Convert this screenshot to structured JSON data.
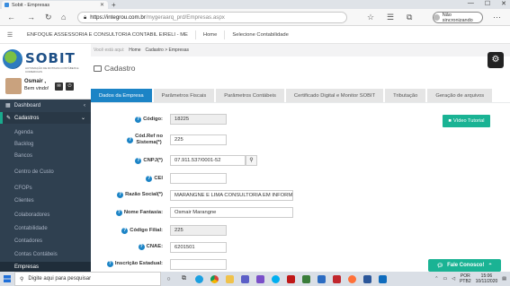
{
  "browser": {
    "tab_title": "Sobit - Empresas",
    "tab_close": "✕",
    "new_tab": "+",
    "url_host": "https://integrou.com.br",
    "url_path": "/mygeraarq_prd/Empresas.aspx",
    "profile_label": "Não sincronizando",
    "win_min": "—",
    "win_max": "☐",
    "win_close": "✕"
  },
  "topnav": {
    "company": "ENFOQUE ASSESSORIA E CONSULTORIA CONTABIL EIRELI - ME",
    "home": "Home",
    "select": "Selecione Contabilidade"
  },
  "logo": {
    "word": "SOBIT",
    "tagline": "AUTOMAÇÃO DE ROTINAS CONTÁBEIS E COMERCIAIS"
  },
  "user": {
    "name": "Osmair ,",
    "welcome": "Bem vindo!"
  },
  "sidebar": {
    "dashboard": "Dashboard",
    "cadastros": "Cadastros",
    "items": [
      "Agenda",
      "Backlog",
      "Bancos",
      "Centro de Custo",
      "CFOPs",
      "Clientes",
      "Colaboradores",
      "Contabilidade",
      "Contadores",
      "Contas Contábeis",
      "Empresas"
    ]
  },
  "breadcrumb": {
    "prefix": "Você está aqui:",
    "home": "Home",
    "path": "Cadastro > Empresas"
  },
  "page": {
    "title": "Cadastro"
  },
  "tabs": [
    "Dados da Empresa",
    "Parâmetros Fiscais",
    "Parâmetros Contábeis",
    "Certificado Digital e Monitor SOBIT",
    "Tributação",
    "Geração de arquivos"
  ],
  "form": {
    "codigo_label": "Código:",
    "codigo": "18225",
    "codref_label1": "Cód.Ref no",
    "codref_label2": "Sistema(*)",
    "codref": "225",
    "cnpj_label": "CNPJ(*)",
    "cnpj": "07.911.537/0001-52",
    "cei_label": "CEI",
    "cei": "",
    "razao_label": "Razão Social(*)",
    "razao": "MARANGNE E LIMA CONSULTORIA EM INFORMATI",
    "fantasia_label": "Nome Fantasia:",
    "fantasia": "Osmair Marangne",
    "filial_label": "Código Filial:",
    "filial": "225",
    "cnae_label": "CNAE:",
    "cnae": "6201501",
    "ie_label": "Inscrição Estadual:",
    "ie": ""
  },
  "video_button": "Vídeo Tutorial",
  "fale_button": "Fale Conosco!",
  "taskbar": {
    "search_placeholder": "Digite aqui para pesquisar",
    "lang1": "POR",
    "lang2": "PTB2",
    "time": "15:06",
    "date": "10/11/2020"
  }
}
